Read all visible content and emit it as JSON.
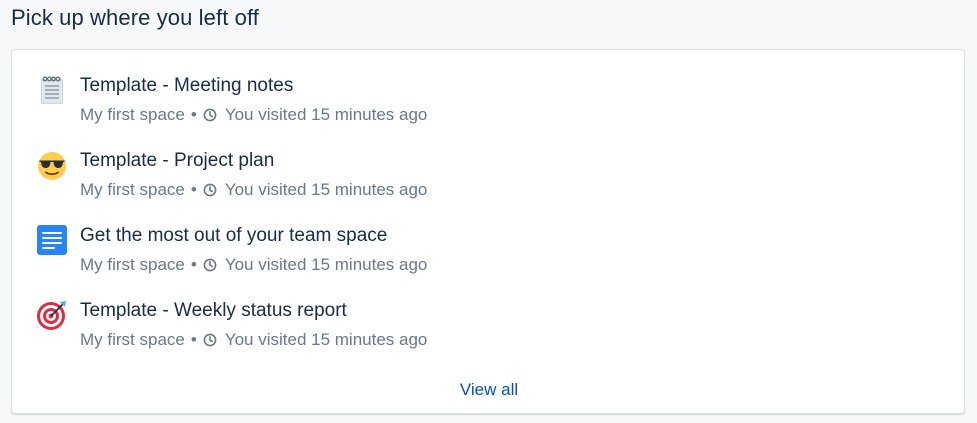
{
  "section": {
    "title": "Pick up where you left off"
  },
  "items": [
    {
      "icon": "notepad-icon",
      "title": "Template - Meeting notes",
      "space": "My first space",
      "visited": "You visited 15 minutes ago"
    },
    {
      "icon": "sunglasses-face-icon",
      "title": "Template - Project plan",
      "space": "My first space",
      "visited": "You visited 15 minutes ago"
    },
    {
      "icon": "document-icon",
      "title": "Get the most out of your team space",
      "space": "My first space",
      "visited": "You visited 15 minutes ago"
    },
    {
      "icon": "target-icon",
      "title": "Template - Weekly status report",
      "space": "My first space",
      "visited": "You visited 15 minutes ago"
    }
  ],
  "footer": {
    "view_all_label": "View all"
  },
  "colors": {
    "text": "#172b4d",
    "subtle": "#6b778c",
    "link": "#0052cc",
    "background": "#f7f8f9"
  }
}
